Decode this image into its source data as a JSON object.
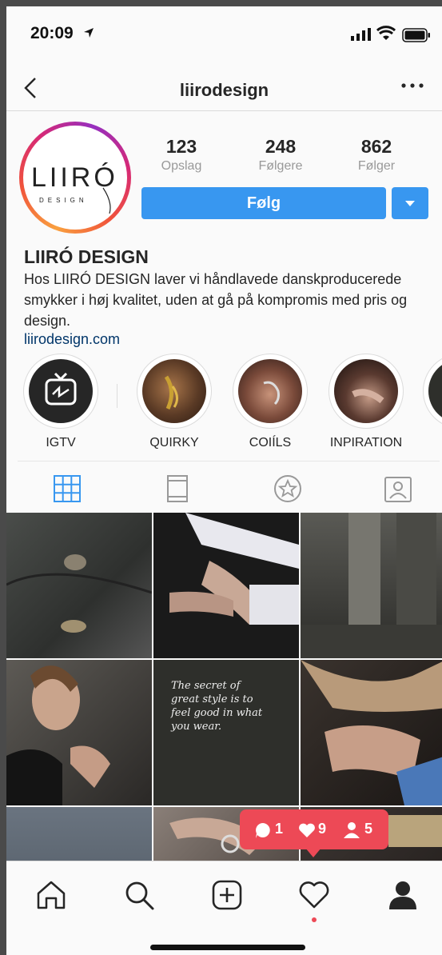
{
  "status_bar": {
    "time": "20:09"
  },
  "nav": {
    "title": "liirodesign"
  },
  "profile": {
    "avatar_logo_text": "LIIRÓ",
    "avatar_logo_sub": "DESIGN",
    "stats": [
      {
        "value": "123",
        "label": "Opslag"
      },
      {
        "value": "248",
        "label": "Følgere"
      },
      {
        "value": "862",
        "label": "Følger"
      }
    ],
    "follow_label": "Følg",
    "name": "LIIRÓ DESIGN",
    "bio": "Hos LIIRÓ DESIGN laver vi håndlavede danskproducerede smykker i høj kvalitet, uden at gå på kompromis med pris og design.",
    "website": "liirodesign.com"
  },
  "highlights": [
    {
      "label": "IGTV"
    },
    {
      "label": "QUIRKY"
    },
    {
      "label": "COIÍLS"
    },
    {
      "label": "INPIRATION"
    },
    {
      "label": ""
    }
  ],
  "grid": {
    "quote_lines": [
      "The secret of",
      "great style is to",
      "feel good in what",
      "you wear."
    ]
  },
  "notifications": {
    "comments": "1",
    "likes": "9",
    "followers": "5"
  },
  "colors": {
    "accent": "#3897f0",
    "notif": "#ed4956"
  }
}
